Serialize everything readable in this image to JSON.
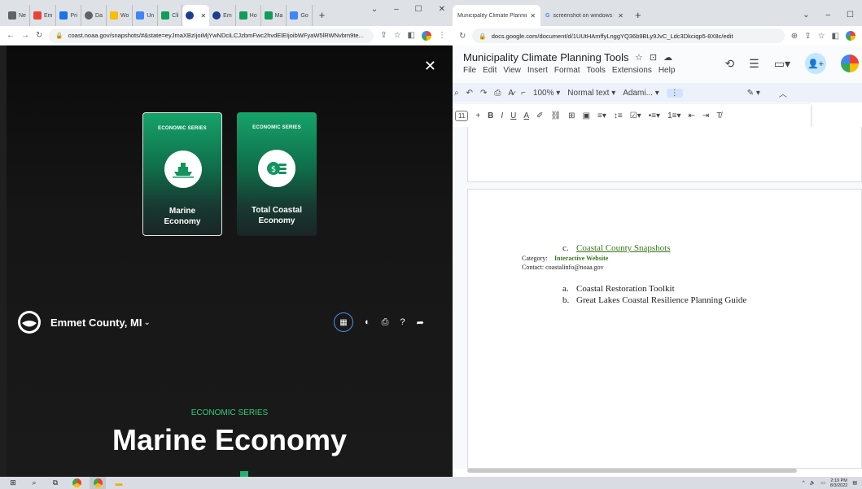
{
  "left_browser": {
    "tabs": [
      {
        "label": "Ne",
        "color": "#5f6368"
      },
      {
        "label": "Em",
        "color": "#ea4335"
      },
      {
        "label": "Pri",
        "color": "#1a73e8"
      },
      {
        "label": "Da",
        "color": "#5f6368"
      },
      {
        "label": "Wo",
        "color": "#fbbc04"
      },
      {
        "label": "Un",
        "color": "#4285f4"
      },
      {
        "label": "Cli",
        "color": "#0f9d58"
      },
      {
        "label": "",
        "color": "#1a3d8f"
      },
      {
        "label": "Em",
        "color": "#1a3d8f"
      },
      {
        "label": "Ho",
        "color": "#0f9d58"
      },
      {
        "label": "Ma",
        "color": "#0f9d58"
      },
      {
        "label": "Go",
        "color": "#4285f4"
      }
    ],
    "new_tab": "+",
    "window_controls": [
      "⌄",
      "–",
      "☐",
      "✕"
    ],
    "url": "coast.noaa.gov/snapshots/#&state=eyJmaXBzIjoiMjYwNDciLCJzbmFwc2hvdElEIjoibWFyaW5lRWNvbm9te..."
  },
  "snapshot": {
    "close_label": "✕",
    "cards": [
      {
        "series": "ECONOMIC SERIES",
        "title_line1": "Marine",
        "title_line2": "Economy"
      },
      {
        "series": "ECONOMIC SERIES",
        "title_line1": "Total Coastal",
        "title_line2": "Economy"
      }
    ],
    "county": "Emmet County, MI",
    "series_label": "ECONOMIC SERIES",
    "title": "Marine Economy"
  },
  "right_browser": {
    "tabs": [
      {
        "label": "Municipality Climate Planning To",
        "active": true
      },
      {
        "label": "screenshot on windows - Googl",
        "active": false
      }
    ],
    "url": "docs.google.com/document/d/1UUtHAmffyLnggYQ36b9BLy9JvC_Ldc3Dkciqp5-8X8c/edit",
    "doc_title": "Municipality Climate Planning Tools",
    "menu": [
      "File",
      "Edit",
      "View",
      "Insert",
      "Format",
      "Tools",
      "Extensions",
      "Help"
    ],
    "toolbar": {
      "zoom": "100%",
      "style": "Normal text",
      "font": "Adami...",
      "font_size": "11"
    },
    "content": {
      "item_c_marker": "c.",
      "item_c_link": "Coastal County Snapshots",
      "category_label": "Category:",
      "category_value": "Interactive Website",
      "contact": "Contact: coastalinfo@noaa.gov",
      "sub_a_marker": "a.",
      "sub_a": "Coastal Restoration Toolkit",
      "sub_b_marker": "b.",
      "sub_b": "Great Lakes Coastal Resilience Planning Guide"
    }
  },
  "taskbar": {
    "time": "2:19 PM",
    "date": "8/3/2022"
  }
}
